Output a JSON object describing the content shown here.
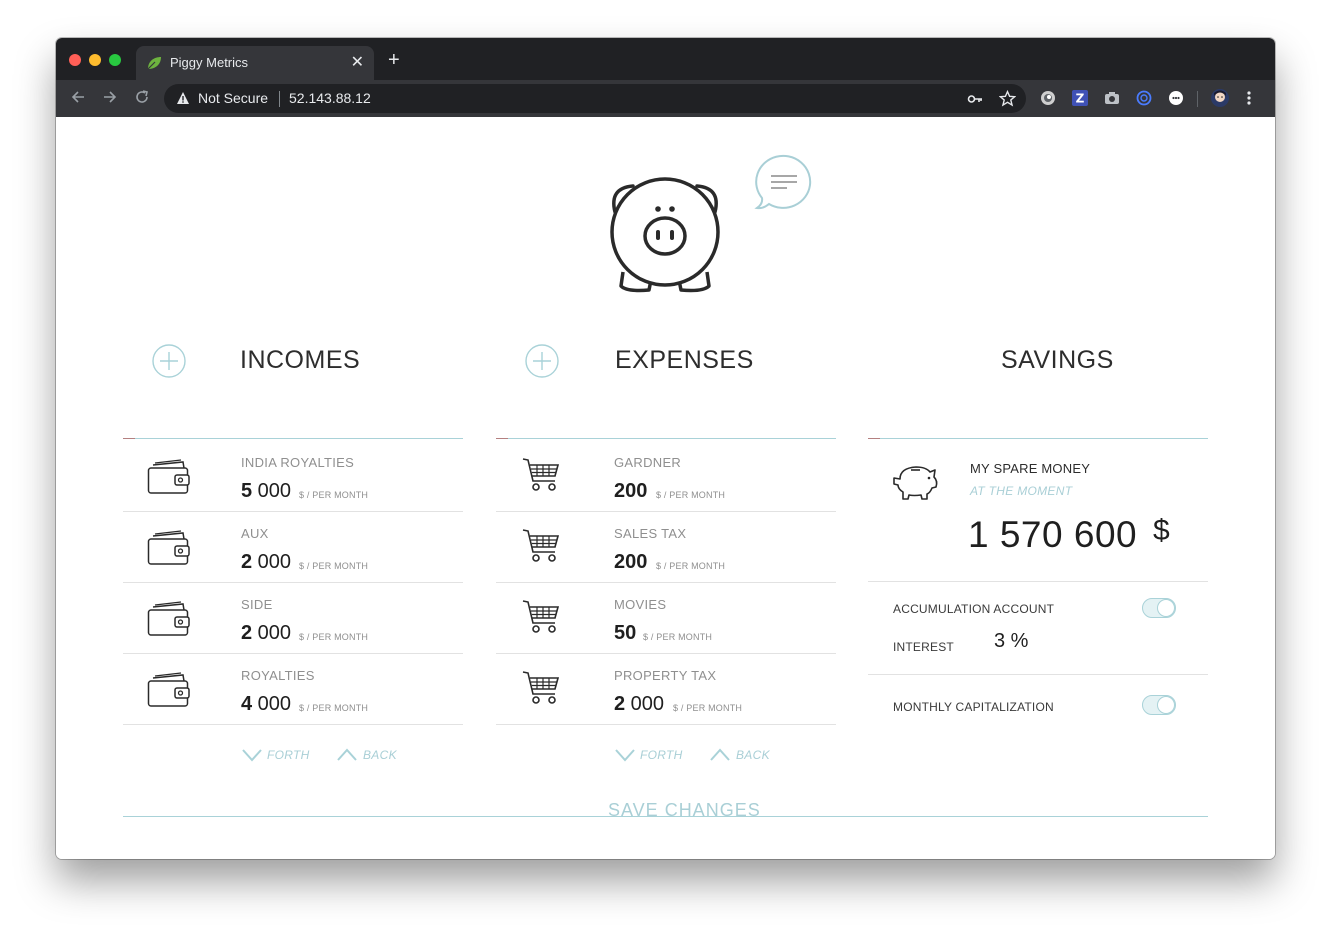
{
  "browser": {
    "tab_title": "Piggy Metrics",
    "tab_close": "✕",
    "new_tab": "+",
    "security_label": "Not Secure",
    "url": "52.143.88.12",
    "extension_z": "Z",
    "colors": {
      "frame": "#202124",
      "toolbar": "#35363a"
    }
  },
  "app": {
    "accent_color": "#a9d2d8",
    "incomes": {
      "title": "INCOMES",
      "item_icon": "wallet-icon",
      "items": [
        {
          "name": "INDIA ROYALTIES",
          "lead": "5",
          "rest": " 000",
          "unit": "$ / PER MONTH"
        },
        {
          "name": "AUX",
          "lead": "2",
          "rest": " 000",
          "unit": "$ / PER MONTH"
        },
        {
          "name": "SIDE",
          "lead": "2",
          "rest": " 000",
          "unit": "$ / PER MONTH"
        },
        {
          "name": "ROYALTIES",
          "lead": "4",
          "rest": " 000",
          "unit": "$ / PER MONTH"
        }
      ],
      "forth": "FORTH",
      "back": "BACK"
    },
    "expenses": {
      "title": "EXPENSES",
      "item_icon": "cart-icon",
      "items": [
        {
          "name": "GARDNER",
          "lead": "200",
          "rest": "",
          "unit": "$ / PER MONTH"
        },
        {
          "name": "SALES TAX",
          "lead": "200",
          "rest": "",
          "unit": "$ / PER MONTH"
        },
        {
          "name": "MOVIES",
          "lead": "50",
          "rest": "",
          "unit": "$ / PER MONTH"
        },
        {
          "name": "PROPERTY TAX",
          "lead": "2",
          "rest": " 000",
          "unit": "$ / PER MONTH"
        }
      ],
      "forth": "FORTH",
      "back": "BACK"
    },
    "savings": {
      "title": "SAVINGS",
      "name": "MY SPARE MONEY",
      "moment": "AT THE MOMENT",
      "amount": "1 570 600",
      "currency": "$",
      "accumulation_label": "ACCUMULATION ACCOUNT",
      "accumulation_on": true,
      "interest_label": "INTEREST",
      "interest_value": "3 %",
      "capitalization_label": "MONTHLY CAPITALIZATION",
      "capitalization_on": true
    },
    "save_label": "SAVE CHANGES"
  }
}
